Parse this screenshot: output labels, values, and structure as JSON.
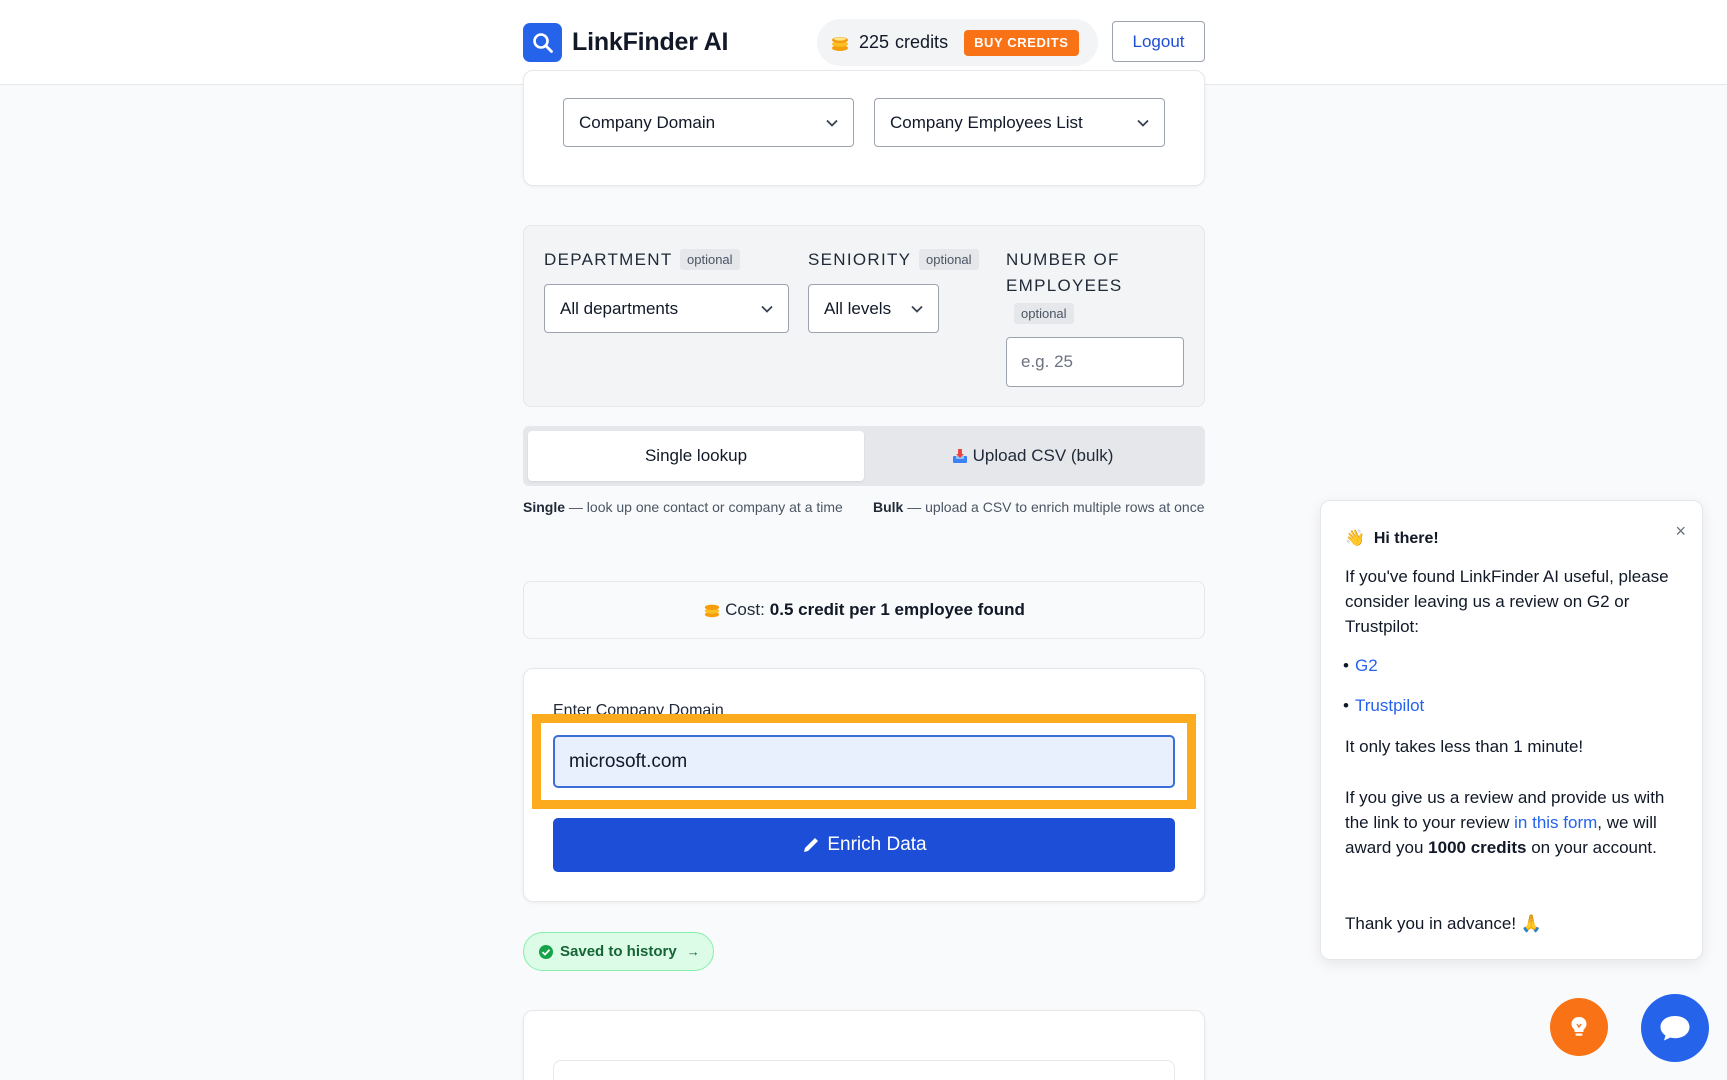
{
  "header": {
    "brand_name": "LinkFinder AI",
    "credits_count": "225",
    "credits_label": "credits",
    "buy_label": "BUY CREDITS",
    "logout_label": "Logout"
  },
  "source": {
    "input_type": "Company Domain",
    "output_type": "Company Employees List"
  },
  "filters": {
    "department_label": "DEPARTMENT",
    "department_value": "All departments",
    "seniority_label": "SENIORITY",
    "seniority_value": "All levels",
    "employees_label_1": "NUMBER OF",
    "employees_label_2": "EMPLOYEES",
    "optional": "optional",
    "employees_placeholder": "e.g. 25"
  },
  "tabs": {
    "single": "Single lookup",
    "bulk": "Upload CSV (bulk)",
    "single_desc_bold": "Single",
    "single_desc": " — look up one contact or company at a time",
    "bulk_desc_bold": "Bulk",
    "bulk_desc": " — upload a CSV to enrich multiple rows at once"
  },
  "cost": {
    "label": "Cost:",
    "value": "0.5 credit per 1 employee found"
  },
  "form": {
    "domain_label": "Enter Company Domain",
    "domain_value": "microsoft.com",
    "enrich_label": "Enrich Data",
    "saved_label": "Saved to history",
    "saved_arrow": "→"
  },
  "popup": {
    "title": "Hi there!",
    "close": "×",
    "intro": "If you've found LinkFinder AI useful, please consider leaving us a review on G2 or Trustpilot:",
    "link_g2": "G2",
    "link_trustpilot": "Trustpilot",
    "minute": "It only takes less than 1 minute!",
    "award_1": "If you give us a review and provide us with the link to your review ",
    "award_link": "in this form",
    "award_2": ", we will award you ",
    "award_bold": "1000 credits",
    "award_3": " on your account.",
    "thanks": "Thank you in advance! 🙏"
  },
  "colors": {
    "accent": "#1d4ed8",
    "brand": "#2563eb",
    "buy": "#f97316",
    "highlight": "#fbab1d",
    "success": "#166534"
  },
  "icons": [
    "search-icon",
    "coins-icon",
    "chevron-down-icon",
    "inbox-tray-icon",
    "pencil-icon",
    "check-circle-icon",
    "close-icon",
    "lightbulb-icon",
    "chat-bubble-icon"
  ]
}
